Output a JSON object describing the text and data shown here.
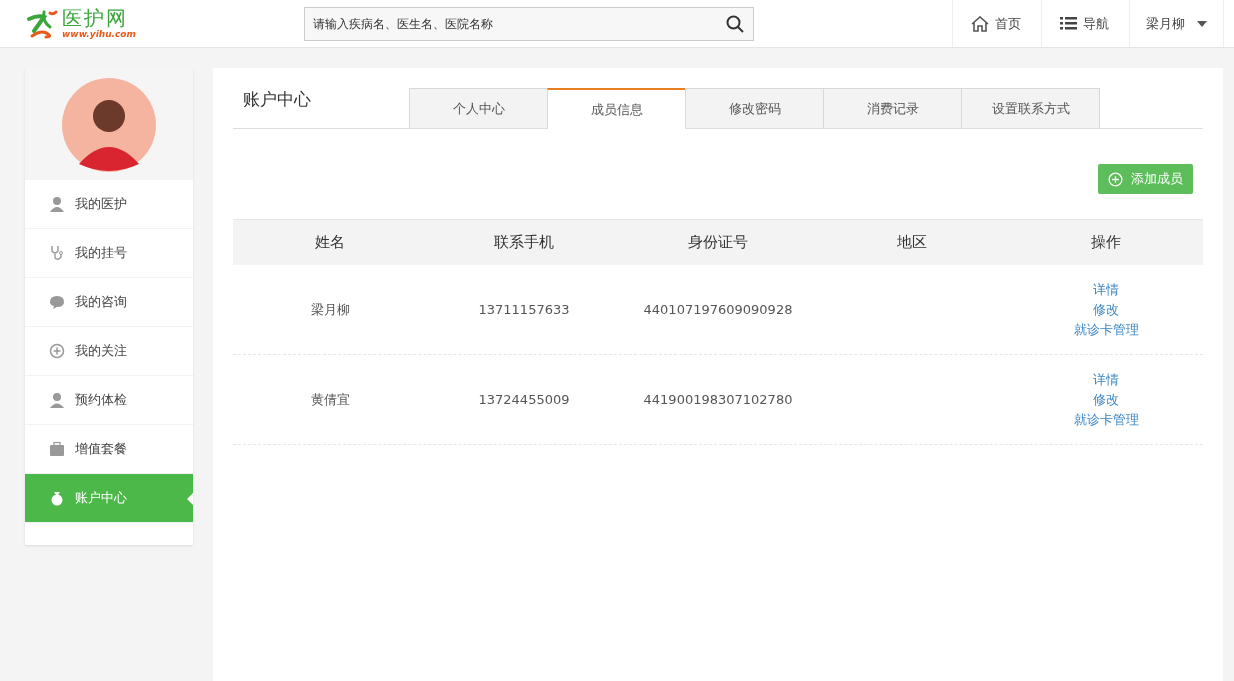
{
  "header": {
    "logo_title": "医护网",
    "logo_url": "www.yihu.com",
    "search": {
      "placeholder": "请输入疾病名、医生名、医院名称"
    },
    "nav": [
      {
        "kind": "home",
        "label": "首页"
      },
      {
        "kind": "list",
        "label": "导航"
      },
      {
        "kind": "user",
        "label": "梁月柳"
      }
    ]
  },
  "sidebar": {
    "items": [
      {
        "kind": "nurse",
        "label": "我的医护",
        "selected": false
      },
      {
        "kind": "stethoscope",
        "label": "我的挂号",
        "selected": false
      },
      {
        "kind": "chat",
        "label": "我的咨询",
        "selected": false
      },
      {
        "kind": "plus",
        "label": "我的关注",
        "selected": false
      },
      {
        "kind": "person",
        "label": "预约体检",
        "selected": false
      },
      {
        "kind": "kit",
        "label": "增值套餐",
        "selected": false
      },
      {
        "kind": "moneybag",
        "label": "账户中心",
        "selected": true
      }
    ]
  },
  "main": {
    "title": "账户中心",
    "tabs": [
      {
        "label": "个人中心",
        "selected": false
      },
      {
        "label": "成员信息",
        "selected": true
      },
      {
        "label": "修改密码",
        "selected": false
      },
      {
        "label": "消费记录",
        "selected": false
      },
      {
        "label": "设置联系方式",
        "selected": false
      }
    ],
    "add_button": "添加成员",
    "table": {
      "columns": [
        "姓名",
        "联系手机",
        "身份证号",
        "地区",
        "操作"
      ],
      "rows": [
        {
          "name": "梁月柳",
          "phone": "13711157633",
          "id_number": "440107197609090928",
          "actions": [
            "详情",
            "修改",
            "就诊卡管理"
          ]
        },
        {
          "name": "黄倩宜",
          "phone": "13724455009",
          "id_number": "441900198307102780",
          "actions": [
            "详情",
            "修改",
            "就诊卡管理"
          ]
        }
      ]
    }
  }
}
